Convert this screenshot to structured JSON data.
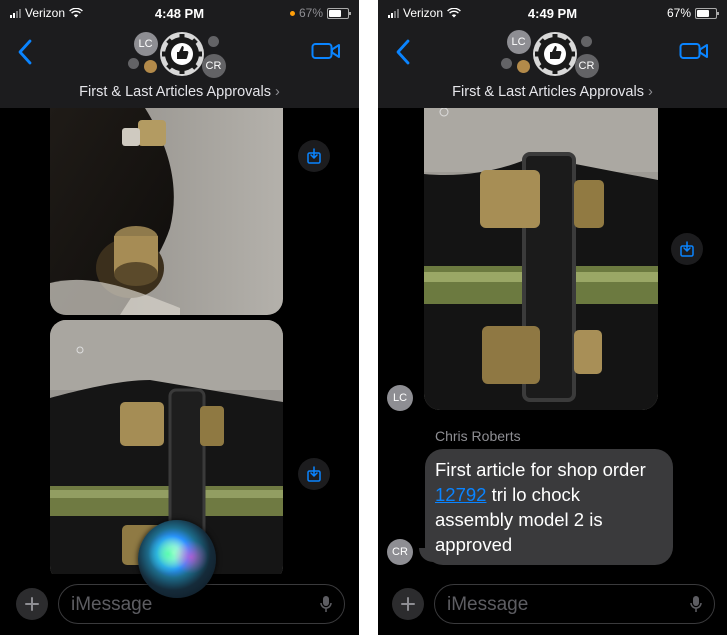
{
  "left_screen": {
    "status": {
      "carrier": "Verizon",
      "time": "4:48 PM",
      "battery": "67%",
      "battery_level": 0.67
    },
    "header": {
      "title": "First & Last Articles Approvals",
      "avatars": [
        "LC",
        "CR"
      ]
    },
    "composer": {
      "placeholder": "iMessage"
    }
  },
  "right_screen": {
    "status": {
      "carrier": "Verizon",
      "time": "4:49 PM",
      "battery": "67%",
      "battery_level": 0.67
    },
    "header": {
      "title": "First & Last Articles Approvals",
      "avatars": [
        "LC",
        "CR"
      ]
    },
    "messages": {
      "photo_sender_avatar": "LC",
      "text_sender_name": "Chris Roberts",
      "text_sender_avatar": "CR",
      "text_before_link": "First article for shop order ",
      "link_text": "12792",
      "text_after_link": " tri lo chock assembly model 2 is approved"
    },
    "composer": {
      "placeholder": "iMessage"
    }
  },
  "colors": {
    "accent": "#0a84ff",
    "bubble_received": "#3a3a3c",
    "header_bg": "#1c1c1e"
  },
  "icons": {
    "back": "chevron-left-icon",
    "video": "video-camera-icon",
    "save": "download-icon",
    "plus": "plus-icon",
    "mic": "microphone-icon",
    "wifi": "wifi-icon",
    "signal": "signal-bars-icon",
    "battery": "battery-icon",
    "siri": "siri-orb-icon"
  }
}
